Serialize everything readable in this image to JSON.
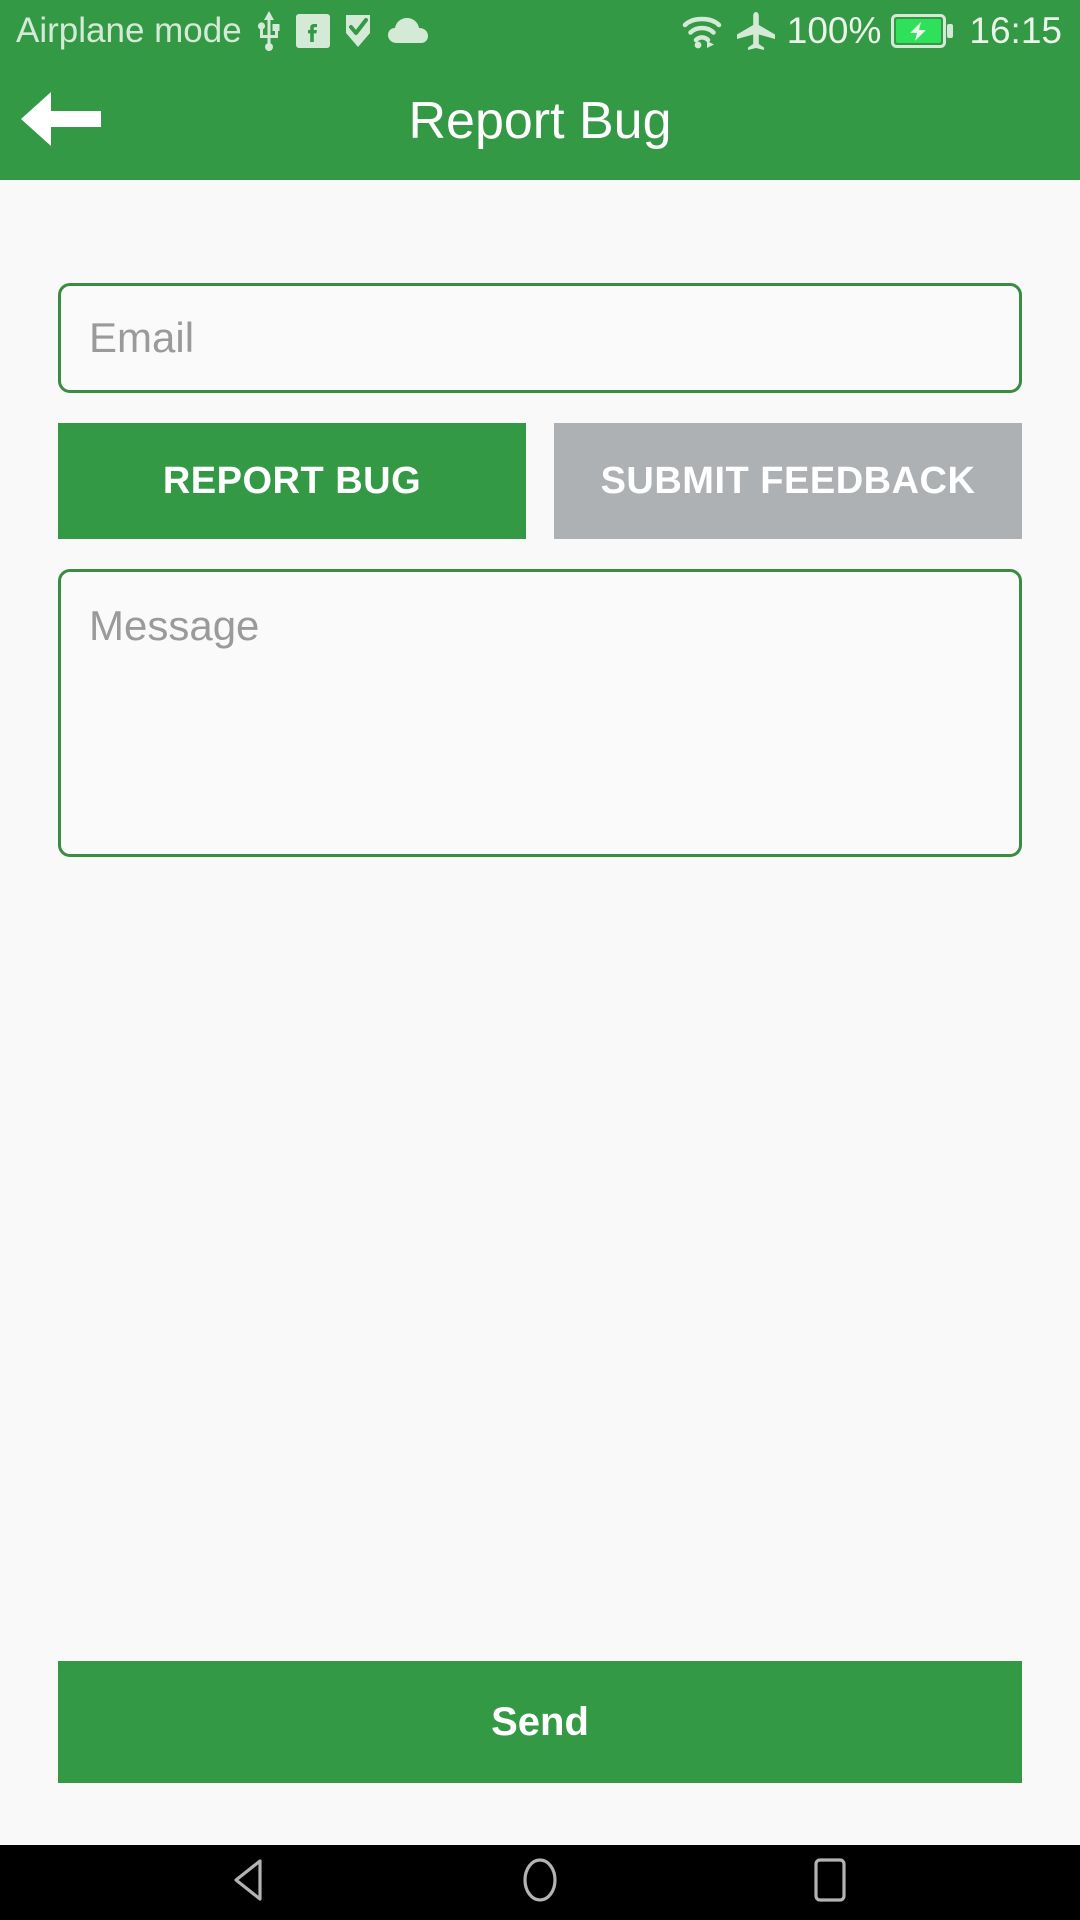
{
  "status_bar": {
    "label": "Airplane mode",
    "left_icons": [
      "usb-icon",
      "facebook-icon",
      "checkmark-flag-icon",
      "cloud-icon"
    ],
    "right_icons": [
      "wifi-icon",
      "airplane-icon",
      "battery-charging-icon"
    ],
    "battery_percent": "100%",
    "time": "16:15",
    "background_color": "#339944",
    "text_color": "#d5e9d7"
  },
  "app_bar": {
    "back_icon": "arrow-left-icon",
    "title": "Report Bug",
    "background_color": "#339944",
    "title_color": "#ffffff"
  },
  "form": {
    "email": {
      "value": "",
      "placeholder": "Email",
      "border_color": "#3a8c43"
    },
    "mode_buttons": [
      {
        "label": "REPORT BUG",
        "state": "selected",
        "color": "#339944"
      },
      {
        "label": "SUBMIT FEEDBACK",
        "state": "unselected",
        "color": "#aeb1b3"
      }
    ],
    "message": {
      "value": "",
      "placeholder": "Message",
      "border_color": "#3a8c43"
    },
    "send_label": "Send",
    "send_color": "#339944"
  },
  "nav_bar": {
    "background_color": "#000000",
    "buttons": [
      {
        "name": "back-triangle-icon"
      },
      {
        "name": "home-circle-icon"
      },
      {
        "name": "recents-square-icon"
      }
    ]
  }
}
